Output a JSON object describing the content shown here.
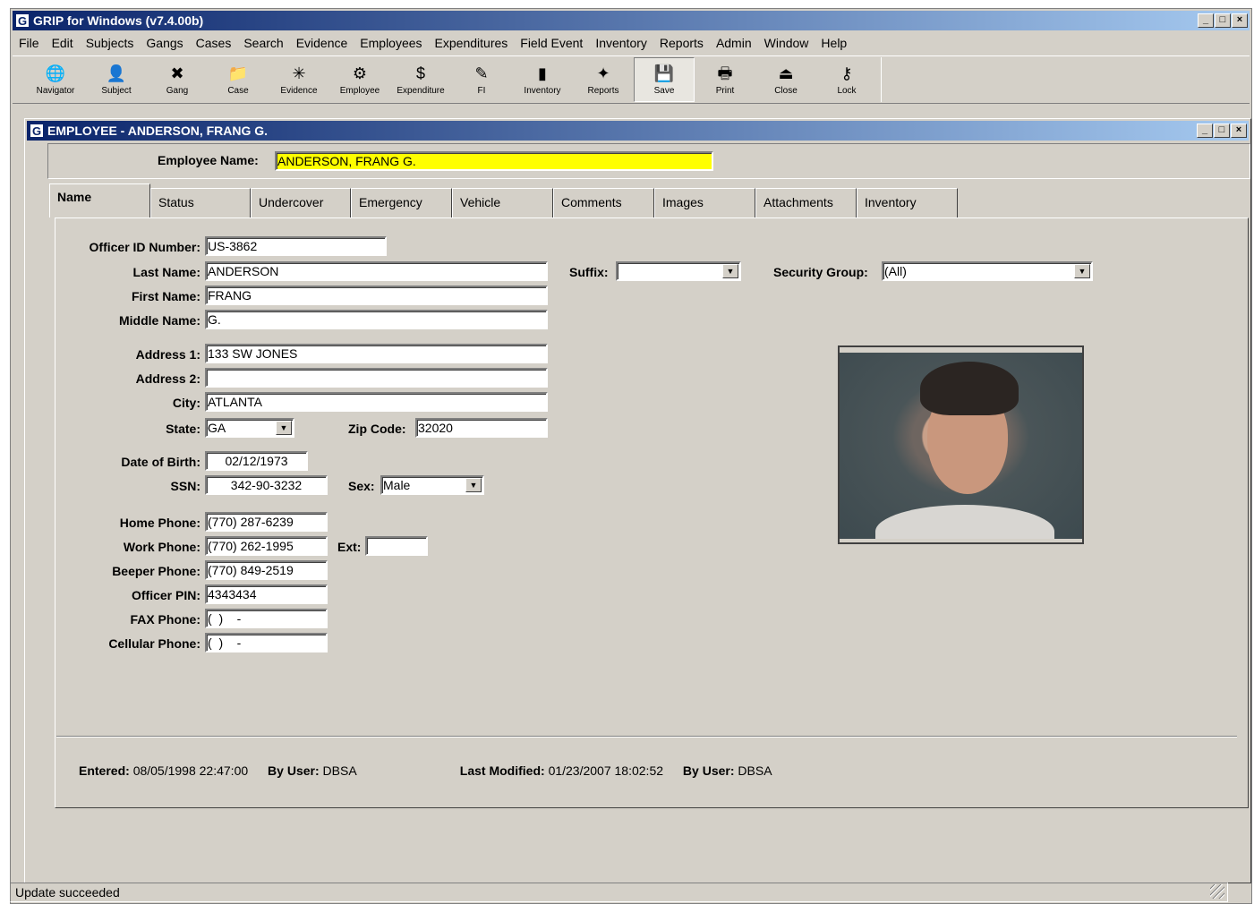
{
  "app": {
    "title": "GRIP for Windows  (v7.4.00b)"
  },
  "menu": [
    "File",
    "Edit",
    "Subjects",
    "Gangs",
    "Cases",
    "Search",
    "Evidence",
    "Employees",
    "Expenditures",
    "Field Event",
    "Inventory",
    "Reports",
    "Admin",
    "Window",
    "Help"
  ],
  "toolbar": [
    {
      "label": "Navigator",
      "icon": "globe-icon",
      "glyph": "🌐"
    },
    {
      "label": "Subject",
      "icon": "subject-icon",
      "glyph": "👤"
    },
    {
      "label": "Gang",
      "icon": "gang-icon",
      "glyph": "✖"
    },
    {
      "label": "Case",
      "icon": "case-icon",
      "glyph": "📁"
    },
    {
      "label": "Evidence",
      "icon": "evidence-icon",
      "glyph": "✳"
    },
    {
      "label": "Employee",
      "icon": "employee-icon",
      "glyph": "⚙"
    },
    {
      "label": "Expenditure",
      "icon": "money-bag-icon",
      "glyph": "$"
    },
    {
      "label": "FI",
      "icon": "fi-icon",
      "glyph": "✎"
    },
    {
      "label": "Inventory",
      "icon": "inventory-icon",
      "glyph": "▮"
    },
    {
      "label": "Reports",
      "icon": "reports-icon",
      "glyph": "✦"
    },
    {
      "label": "Save",
      "icon": "save-icon",
      "glyph": "💾",
      "pressed": true
    },
    {
      "label": "Print",
      "icon": "printer-icon",
      "glyph": "🖶"
    },
    {
      "label": "Close",
      "icon": "close-door-icon",
      "glyph": "⏏"
    },
    {
      "label": "Lock",
      "icon": "key-icon",
      "glyph": "⚷"
    }
  ],
  "child": {
    "title": "EMPLOYEE - ANDERSON, FRANG G."
  },
  "header": {
    "label": "Employee Name:",
    "value": "ANDERSON, FRANG G."
  },
  "tabs": [
    "Name",
    "Status",
    "Undercover",
    "Emergency",
    "Vehicle",
    "Comments",
    "Images",
    "Attachments",
    "Inventory"
  ],
  "form": {
    "officer_id": {
      "label": "Officer ID Number:",
      "value": "US-3862"
    },
    "last_name": {
      "label": "Last Name:",
      "value": "ANDERSON"
    },
    "first_name": {
      "label": "First Name:",
      "value": "FRANG"
    },
    "middle_name": {
      "label": "Middle Name:",
      "value": "G."
    },
    "suffix": {
      "label": "Suffix:",
      "value": ""
    },
    "security_group": {
      "label": "Security Group:",
      "value": "(All)"
    },
    "address1": {
      "label": "Address 1:",
      "value": "133 SW JONES"
    },
    "address2": {
      "label": "Address 2:",
      "value": ""
    },
    "city": {
      "label": "City:",
      "value": "ATLANTA"
    },
    "state": {
      "label": "State:",
      "value": "GA"
    },
    "zip": {
      "label": "Zip Code:",
      "value": "32020"
    },
    "dob": {
      "label": "Date of Birth:",
      "value": "02/12/1973"
    },
    "ssn": {
      "label": "SSN:",
      "value": "342-90-3232"
    },
    "sex": {
      "label": "Sex:",
      "value": "Male"
    },
    "home_phone": {
      "label": "Home Phone:",
      "value": "(770) 287-6239"
    },
    "work_phone": {
      "label": "Work Phone:",
      "value": "(770) 262-1995"
    },
    "ext": {
      "label": "Ext:",
      "value": ""
    },
    "beeper_phone": {
      "label": "Beeper Phone:",
      "value": "(770) 849-2519"
    },
    "officer_pin": {
      "label": "Officer PIN:",
      "value": "4343434"
    },
    "fax_phone": {
      "label": "FAX Phone:",
      "value": "(  )    -"
    },
    "cell_phone": {
      "label": "Cellular Phone:",
      "value": "(  )    -"
    }
  },
  "footer": {
    "entered_label": "Entered:",
    "entered_value": "08/05/1998 22:47:00",
    "by_user_label": "By User:",
    "entered_by": "DBSA",
    "modified_label": "Last Modified:",
    "modified_value": "01/23/2007 18:02:52",
    "modified_by": "DBSA"
  },
  "status": "Update succeeded"
}
